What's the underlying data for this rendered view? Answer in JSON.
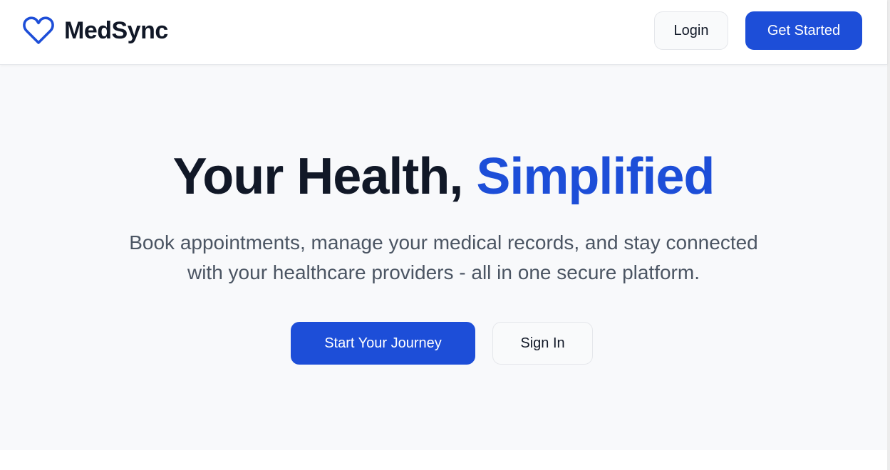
{
  "header": {
    "brand_name": "MedSync",
    "brand_icon": "heart-icon",
    "login_label": "Login",
    "get_started_label": "Get Started"
  },
  "hero": {
    "title_main": "Your Health, ",
    "title_accent": "Simplified",
    "subtitle_lines": [
      "Book appointments, manage your medical records, and stay connected",
      "with your healthcare providers - all in one secure platform."
    ],
    "primary_cta_label": "Start Your Journey",
    "secondary_cta_label": "Sign In"
  },
  "colors": {
    "accent": "#1d4ed8",
    "heading": "#111827",
    "body_text": "#4b5563",
    "hero_background": "#f8f9fb",
    "header_background": "#ffffff"
  }
}
